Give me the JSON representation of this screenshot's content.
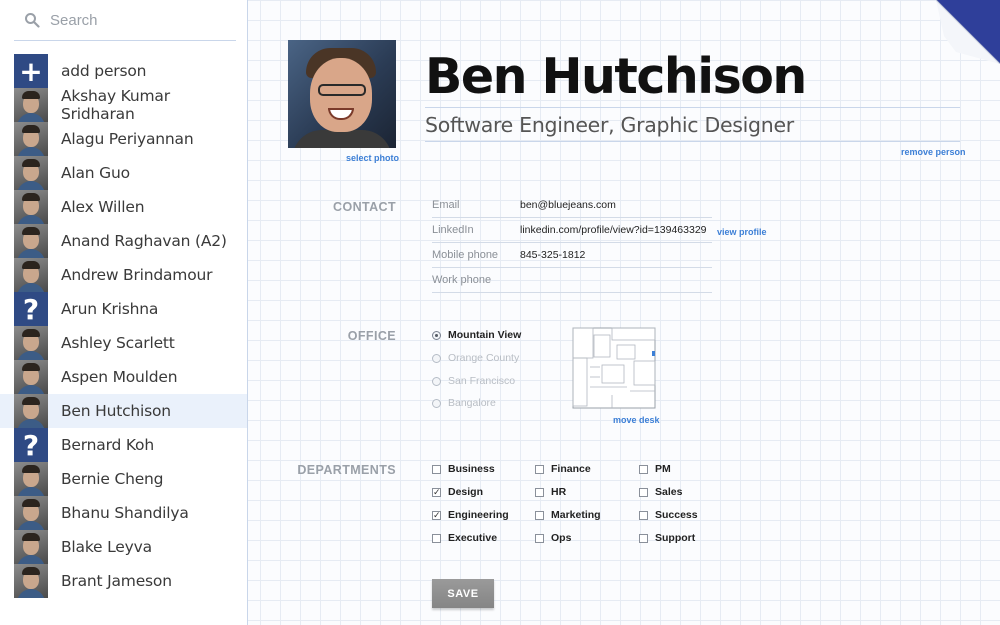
{
  "search": {
    "placeholder": "Search"
  },
  "sidebar": {
    "people": [
      {
        "name": "add person",
        "avatar": "plus-icon",
        "kind": "add"
      },
      {
        "name": "Akshay Kumar Sridharan",
        "kind": "photo"
      },
      {
        "name": "Alagu Periyannan",
        "kind": "photo"
      },
      {
        "name": "Alan Guo",
        "kind": "photo"
      },
      {
        "name": "Alex Willen",
        "kind": "photo"
      },
      {
        "name": "Anand Raghavan (A2)",
        "kind": "photo"
      },
      {
        "name": "Andrew Brindamour",
        "kind": "photo"
      },
      {
        "name": "Arun Krishna",
        "kind": "unknown"
      },
      {
        "name": "Ashley Scarlett",
        "kind": "photo"
      },
      {
        "name": "Aspen Moulden",
        "kind": "photo"
      },
      {
        "name": "Ben Hutchison",
        "kind": "photo",
        "selected": true
      },
      {
        "name": "Bernard Koh",
        "kind": "unknown"
      },
      {
        "name": "Bernie Cheng",
        "kind": "photo"
      },
      {
        "name": "Bhanu Shandilya",
        "kind": "photo"
      },
      {
        "name": "Blake Leyva",
        "kind": "photo"
      },
      {
        "name": "Brant Jameson",
        "kind": "photo"
      }
    ]
  },
  "profile": {
    "name": "Ben Hutchison",
    "title": "Software Engineer, Graphic Designer",
    "select_photo": "select photo",
    "remove_person": "remove person"
  },
  "contact": {
    "label": "CONTACT",
    "fields": [
      {
        "label": "Email",
        "value": "ben@bluejeans.com"
      },
      {
        "label": "LinkedIn",
        "value": "linkedin.com/profile/view?id=139463329"
      },
      {
        "label": "Mobile phone",
        "value": "845-325-1812"
      },
      {
        "label": "Work phone",
        "value": ""
      }
    ],
    "view_profile": "view profile"
  },
  "office": {
    "label": "OFFICE",
    "options": [
      {
        "label": "Mountain View",
        "selected": true
      },
      {
        "label": "Orange County",
        "selected": false
      },
      {
        "label": "San Francisco",
        "selected": false
      },
      {
        "label": "Bangalore",
        "selected": false
      }
    ],
    "move_desk": "move desk"
  },
  "departments": {
    "label": "DEPARTMENTS",
    "items": [
      {
        "label": "Business",
        "checked": false
      },
      {
        "label": "Design",
        "checked": true
      },
      {
        "label": "Engineering",
        "checked": true
      },
      {
        "label": "Executive",
        "checked": false
      },
      {
        "label": "Finance",
        "checked": false
      },
      {
        "label": "HR",
        "checked": false
      },
      {
        "label": "Marketing",
        "checked": false
      },
      {
        "label": "Ops",
        "checked": false
      },
      {
        "label": "PM",
        "checked": false
      },
      {
        "label": "Sales",
        "checked": false
      },
      {
        "label": "Success",
        "checked": false
      },
      {
        "label": "Support",
        "checked": false
      }
    ]
  },
  "actions": {
    "save": "SAVE"
  },
  "colors": {
    "accent": "#3c7fd6",
    "selected_row": "#eaf1fb",
    "corner": "#2f3f9a"
  }
}
